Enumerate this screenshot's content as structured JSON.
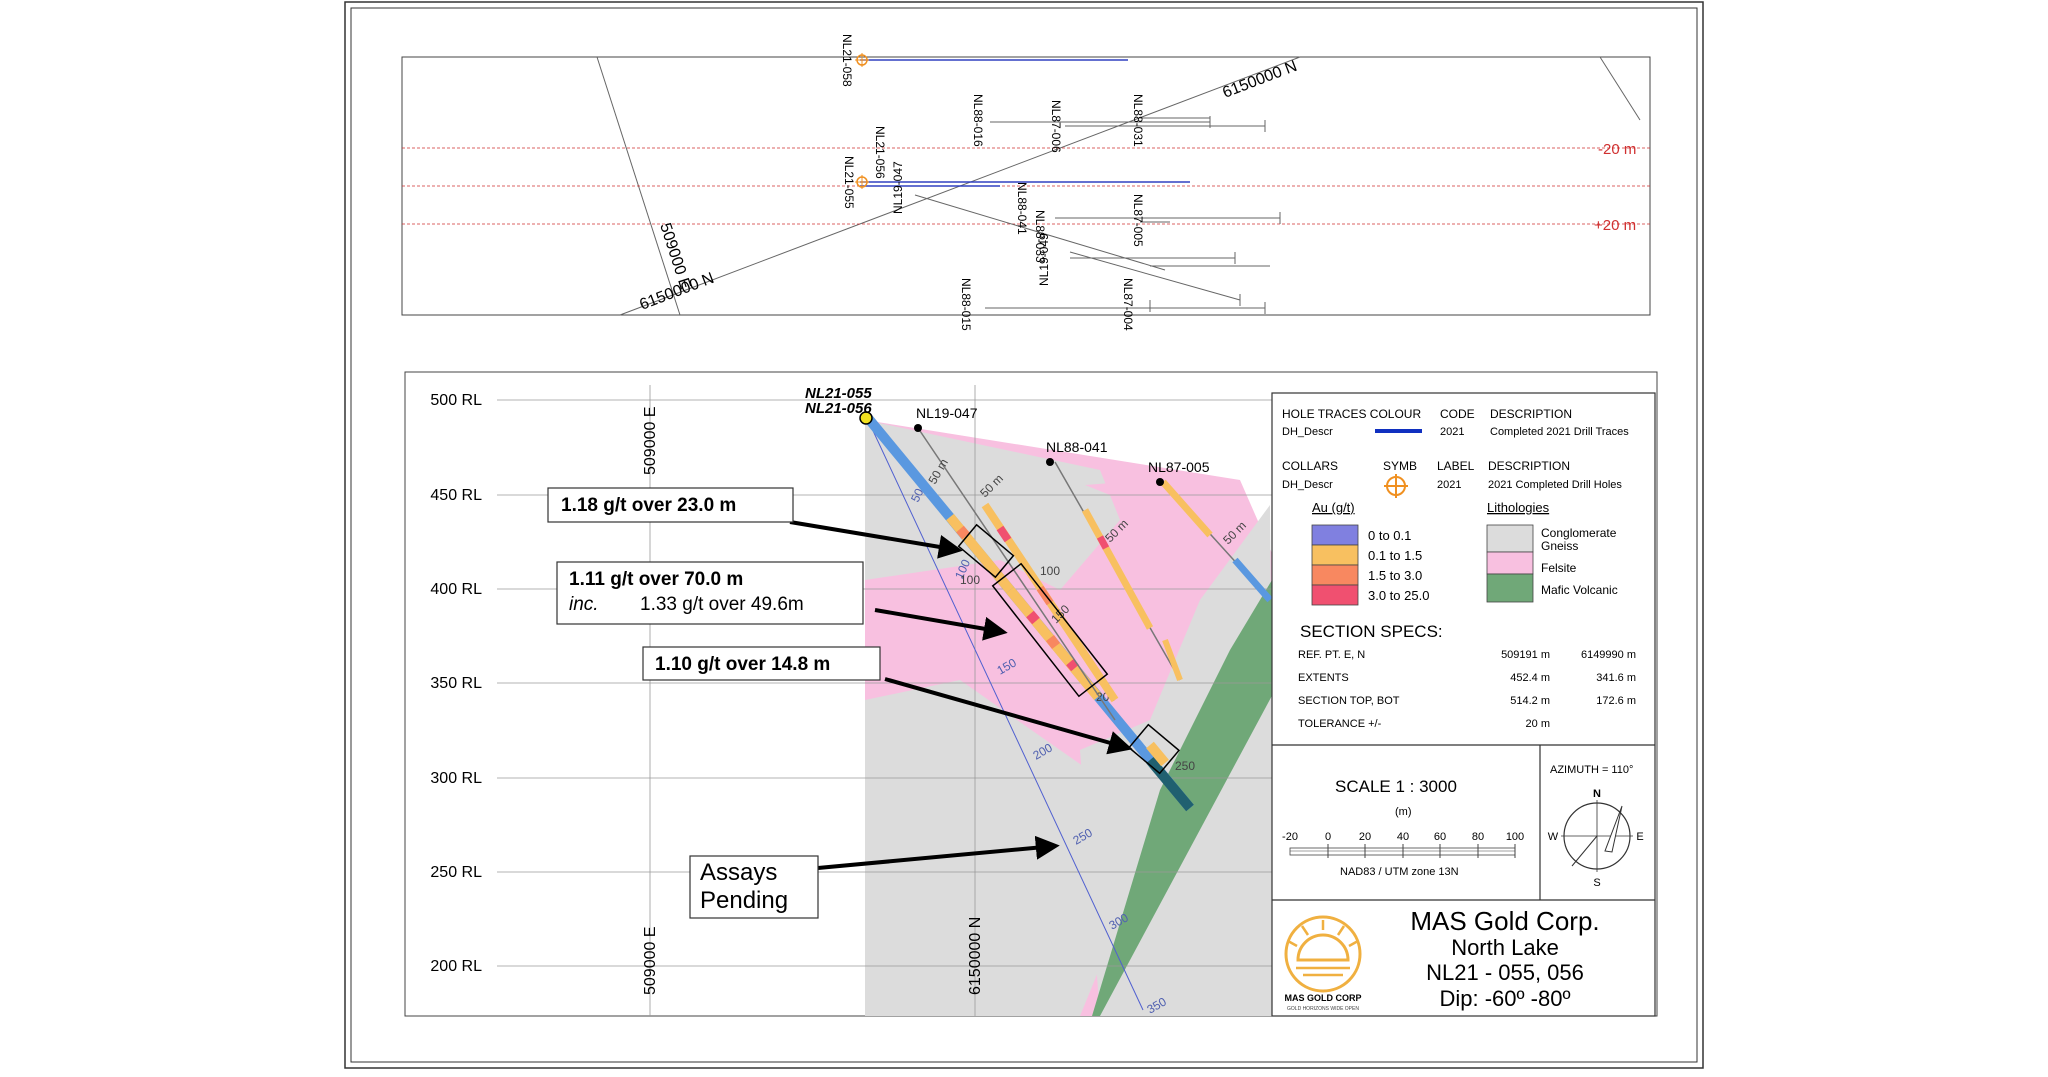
{
  "plan": {
    "grid_labels": {
      "north_top": "6150000 N",
      "north_bottom": "6150000 N",
      "east": "509000 E"
    },
    "tolerance_labels": [
      "-20 m",
      "+20 m"
    ],
    "holes": [
      "NL21-058",
      "NL88-016",
      "NL87-006",
      "NL88-031",
      "NL21-056",
      "NL21-055",
      "NL19-047",
      "NL88-041",
      "NL88-033",
      "NL87-005",
      "NL19-049",
      "NL88-015",
      "NL87-004"
    ]
  },
  "section": {
    "rl_labels": [
      "500 RL",
      "450 RL",
      "400 RL",
      "350 RL",
      "300 RL",
      "250 RL",
      "200 RL"
    ],
    "easting_labels": [
      "509000 E",
      "509000 E"
    ],
    "northing_label": "6150000 N",
    "hole_labels": {
      "nl21_055": "NL21-055",
      "nl21_056": "NL21-056",
      "nl19_047": "NL19-047",
      "nl88_041": "NL88-041",
      "nl87_005": "NL87-005"
    },
    "depth_ticks": [
      "50",
      "100",
      "150",
      "200",
      "250",
      "300",
      "350",
      "50",
      "100",
      "150",
      "200",
      "250"
    ],
    "short_depth_labels": [
      "50 m",
      "50 m",
      "50 m",
      "50 m",
      "100",
      "150",
      "100",
      "50"
    ],
    "callouts": {
      "c1": "1.18 g/t over 23.0 m",
      "c2_main": "1.11 g/t over 70.0 m",
      "c2_inc_label": "inc.",
      "c2_inc_value": "1.33 g/t over 49.6m",
      "c3": "1.10 g/t over 14.8 m",
      "pending_1": "Assays",
      "pending_2": "Pending"
    }
  },
  "legend": {
    "header_hole": "HOLE TRACES COLOUR",
    "header_code": "CODE",
    "header_desc": "DESCRIPTION",
    "row_hole": "DH_Descr",
    "row_code": "2021",
    "row_desc": "Completed 2021 Drill Traces",
    "collars_title": "COLLARS",
    "symb": "SYMB",
    "label_title": "LABEL",
    "collar_desc_title": "DESCRIPTION",
    "collars_row": "DH_Descr",
    "collar_label": "2021",
    "collar_desc": "2021 Completed Drill Holes",
    "au_title": "Au (g/t)",
    "lith_title": "Lithologies",
    "au_bins": [
      {
        "label": "0 to 0.1",
        "color": "#8080e0"
      },
      {
        "label": "0.1 to 1.5",
        "color": "#f8c060"
      },
      {
        "label": "1.5 to 3.0",
        "color": "#f88860"
      },
      {
        "label": "3.0 to 25.0",
        "color": "#f05070"
      }
    ],
    "lithologies": [
      {
        "label": "Conglomerate Gneiss",
        "color": "#dcdcdc"
      },
      {
        "label": "Felsite",
        "color": "#f8c0e0"
      },
      {
        "label": "Mafic Volcanic",
        "color": "#70a878"
      }
    ],
    "specs_title": "SECTION  SPECS:",
    "specs": [
      {
        "label": "REF. PT.  E, N",
        "v1": "509191 m",
        "v2": "6149990 m"
      },
      {
        "label": "EXTENTS",
        "v1": "452.4 m",
        "v2": "341.6 m"
      },
      {
        "label": "SECTION TOP, BOT",
        "v1": "514.2 m",
        "v2": "172.6 m"
      },
      {
        "label": "TOLERANCE  +/-",
        "v1": "20 m",
        "v2": ""
      }
    ],
    "scale_title": "SCALE   1 : 3000",
    "scale_unit": "(m)",
    "scale_ticks": [
      "-20",
      "0",
      "20",
      "40",
      "60",
      "80",
      "100"
    ],
    "datum": "NAD83 / UTM zone 13N",
    "azimuth": "AZIMUTH = 110°",
    "compass": {
      "n": "N",
      "s": "S",
      "e": "E",
      "w": "W"
    },
    "company": "MAS Gold Corp.",
    "project": "North Lake",
    "holes": "NL21 - 055, 056",
    "dip": "Dip:   -60º -80º",
    "logo_text": "MAS GOLD CORP",
    "logo_tagline": "GOLD HORIZONS WIDE OPEN"
  },
  "colors": {
    "gneiss": "#dcdcdc",
    "felsite": "#f8c0e0",
    "mafic": "#70a878",
    "trace_2021": "#1030c0",
    "collar": "#f09020",
    "tolerance": "#d03030",
    "gold": "#f0b040"
  }
}
